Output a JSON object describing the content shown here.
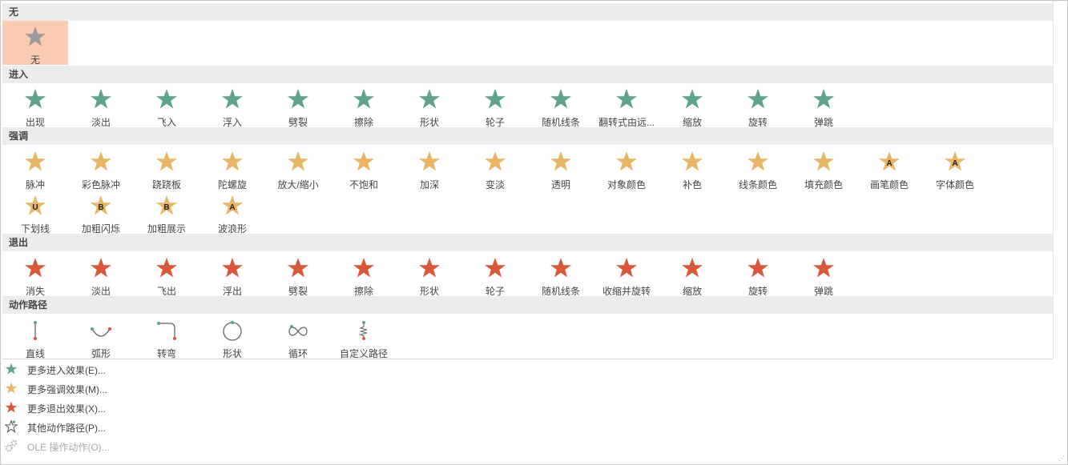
{
  "colors": {
    "none": "#9a9a9a",
    "entrance": "#5fa38a",
    "emphasis": "#e9b666",
    "exit": "#d9583a",
    "selected_bg": "#fbcbb4",
    "path": "#666666"
  },
  "sections": [
    {
      "title": "无",
      "kind": "none",
      "items": [
        {
          "label": "无",
          "selected": true
        }
      ]
    },
    {
      "title": "进入",
      "kind": "entrance",
      "items": [
        {
          "label": "出现",
          "icon": "appear-icon"
        },
        {
          "label": "淡出",
          "icon": "fade-icon"
        },
        {
          "label": "飞入",
          "icon": "fly-in-icon"
        },
        {
          "label": "浮入",
          "icon": "float-in-icon"
        },
        {
          "label": "劈裂",
          "icon": "split-icon"
        },
        {
          "label": "擦除",
          "icon": "wipe-icon"
        },
        {
          "label": "形状",
          "icon": "shape-icon"
        },
        {
          "label": "轮子",
          "icon": "wheel-icon"
        },
        {
          "label": "随机线条",
          "icon": "random-bars-icon"
        },
        {
          "label": "翻转式由远...",
          "icon": "grow-turn-icon"
        },
        {
          "label": "缩放",
          "icon": "zoom-icon"
        },
        {
          "label": "旋转",
          "icon": "swivel-icon"
        },
        {
          "label": "弹跳",
          "icon": "bounce-icon"
        }
      ]
    },
    {
      "title": "强调",
      "kind": "emphasis",
      "items": [
        {
          "label": "脉冲",
          "icon": "pulse-icon"
        },
        {
          "label": "彩色脉冲",
          "icon": "color-pulse-icon"
        },
        {
          "label": "跷跷板",
          "icon": "teeter-icon"
        },
        {
          "label": "陀螺旋",
          "icon": "spin-icon"
        },
        {
          "label": "放大/缩小",
          "icon": "grow-shrink-icon"
        },
        {
          "label": "不饱和",
          "icon": "desaturate-icon"
        },
        {
          "label": "加深",
          "icon": "darken-icon"
        },
        {
          "label": "变淡",
          "icon": "lighten-icon"
        },
        {
          "label": "透明",
          "icon": "transparency-icon"
        },
        {
          "label": "对象颜色",
          "icon": "object-color-icon"
        },
        {
          "label": "补色",
          "icon": "complementary-color-icon"
        },
        {
          "label": "线条颜色",
          "icon": "line-color-icon"
        },
        {
          "label": "填充颜色",
          "icon": "fill-color-icon"
        },
        {
          "label": "画笔颜色",
          "icon": "brush-color-icon",
          "letter": "A"
        },
        {
          "label": "字体颜色",
          "icon": "font-color-icon",
          "letter": "A"
        },
        {
          "label": "下划线",
          "icon": "underline-icon",
          "letter": "U"
        },
        {
          "label": "加粗闪烁",
          "icon": "bold-flash-icon",
          "letter": "B"
        },
        {
          "label": "加粗展示",
          "icon": "bold-reveal-icon",
          "letter": "B"
        },
        {
          "label": "波浪形",
          "icon": "wave-icon",
          "letter": "A"
        }
      ]
    },
    {
      "title": "退出",
      "kind": "exit",
      "items": [
        {
          "label": "消失",
          "icon": "disappear-icon"
        },
        {
          "label": "淡出",
          "icon": "fade-icon"
        },
        {
          "label": "飞出",
          "icon": "fly-out-icon"
        },
        {
          "label": "浮出",
          "icon": "float-out-icon"
        },
        {
          "label": "劈裂",
          "icon": "split-icon"
        },
        {
          "label": "擦除",
          "icon": "wipe-icon"
        },
        {
          "label": "形状",
          "icon": "shape-icon"
        },
        {
          "label": "轮子",
          "icon": "wheel-icon"
        },
        {
          "label": "随机线条",
          "icon": "random-bars-icon"
        },
        {
          "label": "收缩并旋转",
          "icon": "shrink-turn-icon"
        },
        {
          "label": "缩放",
          "icon": "zoom-icon"
        },
        {
          "label": "旋转",
          "icon": "swivel-icon"
        },
        {
          "label": "弹跳",
          "icon": "bounce-icon"
        }
      ]
    },
    {
      "title": "动作路径",
      "kind": "path",
      "items": [
        {
          "label": "直线",
          "icon": "line-path-icon",
          "path": "line"
        },
        {
          "label": "弧形",
          "icon": "arc-path-icon",
          "path": "arc"
        },
        {
          "label": "转弯",
          "icon": "turn-path-icon",
          "path": "turn"
        },
        {
          "label": "形状",
          "icon": "shape-path-icon",
          "path": "circle"
        },
        {
          "label": "循环",
          "icon": "loop-path-icon",
          "path": "loop"
        },
        {
          "label": "自定义路径",
          "icon": "custom-path-icon",
          "path": "custom"
        }
      ]
    }
  ],
  "menu": [
    {
      "label": "更多进入效果(E)...",
      "kind": "entrance",
      "enabled": true
    },
    {
      "label": "更多强调效果(M)...",
      "kind": "emphasis",
      "enabled": true
    },
    {
      "label": "更多退出效果(X)...",
      "kind": "exit",
      "enabled": true
    },
    {
      "label": "其他动作路径(P)...",
      "kind": "path",
      "enabled": true
    },
    {
      "label": "OLE 操作动作(O)...",
      "kind": "ole",
      "enabled": false
    }
  ]
}
